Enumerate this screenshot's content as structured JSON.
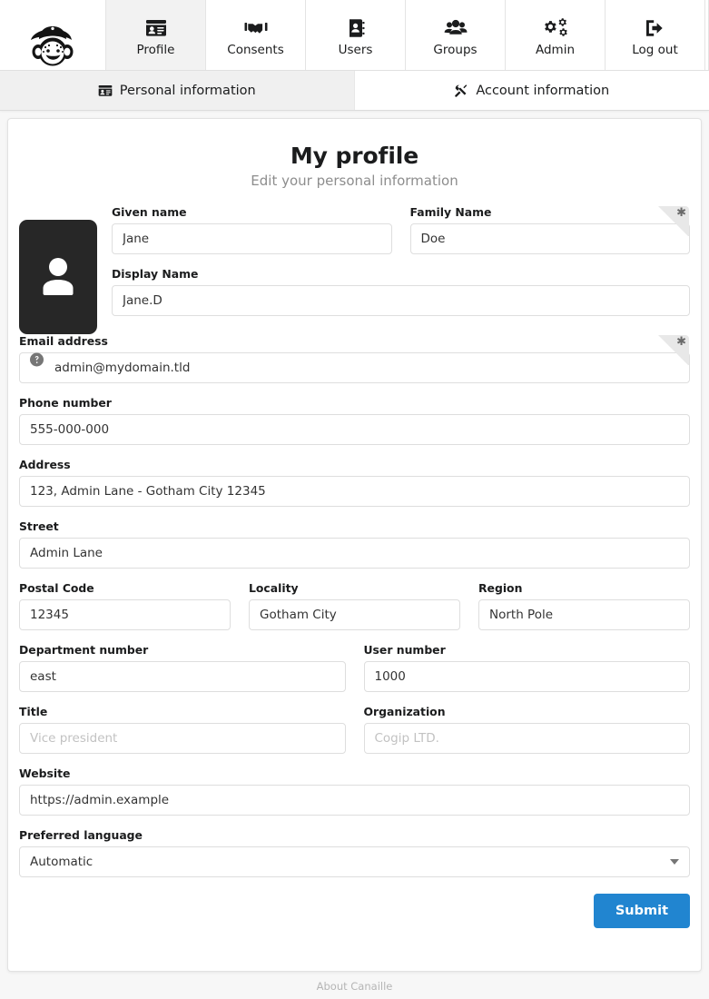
{
  "app": {
    "name": "Canaille"
  },
  "nav": {
    "logo_icon": "canaille-mascot-logo",
    "items": [
      {
        "label": "Profile",
        "icon": "id-card-icon",
        "active": true
      },
      {
        "label": "Consents",
        "icon": "handshake-icon",
        "active": false
      },
      {
        "label": "Users",
        "icon": "address-book-icon",
        "active": false
      },
      {
        "label": "Groups",
        "icon": "users-icon",
        "active": false
      },
      {
        "label": "Admin",
        "icon": "cogs-icon",
        "active": false
      },
      {
        "label": "Log out",
        "icon": "sign-out-icon",
        "active": false
      }
    ]
  },
  "tabs": [
    {
      "label": "Personal information",
      "icon": "id-card-icon",
      "active": true
    },
    {
      "label": "Account information",
      "icon": "tools-icon",
      "active": false
    }
  ],
  "page": {
    "title": "My profile",
    "subtitle": "Edit your personal information",
    "avatar_icon": "user-placeholder-icon"
  },
  "form": {
    "given_name": {
      "label": "Given name",
      "value": "Jane",
      "placeholder": ""
    },
    "family_name": {
      "label": "Family Name",
      "value": "Doe",
      "placeholder": "",
      "required_mark": "✱"
    },
    "display_name": {
      "label": "Display Name",
      "value": "Jane.D",
      "placeholder": ""
    },
    "email": {
      "label": "Email address",
      "value": "admin@mydomain.tld",
      "placeholder": "",
      "required_mark": "✱",
      "icon": "help-circle-icon"
    },
    "phone": {
      "label": "Phone number",
      "value": "555-000-000",
      "placeholder": ""
    },
    "address": {
      "label": "Address",
      "value": "123, Admin Lane - Gotham City 12345",
      "placeholder": ""
    },
    "street": {
      "label": "Street",
      "value": "Admin Lane",
      "placeholder": ""
    },
    "postal_code": {
      "label": "Postal Code",
      "value": "12345",
      "placeholder": ""
    },
    "locality": {
      "label": "Locality",
      "value": "Gotham City",
      "placeholder": ""
    },
    "region": {
      "label": "Region",
      "value": "North Pole",
      "placeholder": ""
    },
    "department": {
      "label": "Department number",
      "value": "east",
      "placeholder": ""
    },
    "user_number": {
      "label": "User number",
      "value": "1000",
      "placeholder": ""
    },
    "title": {
      "label": "Title",
      "value": "",
      "placeholder": "Vice president"
    },
    "organization": {
      "label": "Organization",
      "value": "",
      "placeholder": "Cogip LTD."
    },
    "website": {
      "label": "Website",
      "value": "https://admin.example",
      "placeholder": ""
    },
    "language": {
      "label": "Preferred language",
      "value": "Automatic",
      "options": [
        "Automatic"
      ]
    },
    "submit_label": "Submit"
  },
  "footer": {
    "about_label": "About Canaille"
  },
  "colors": {
    "accent": "#2185d0",
    "page_bg": "#f7f7f7",
    "card_bg": "#ffffff",
    "active_tab_bg": "#f0f0f0",
    "avatar_bg": "#272727",
    "muted_text": "#8d8d8d"
  }
}
